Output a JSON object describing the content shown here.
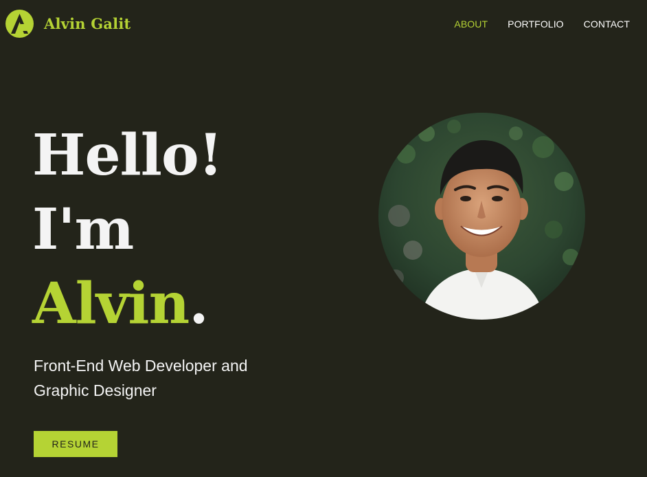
{
  "header": {
    "brand_name": "Alvin Galit",
    "nav": [
      {
        "label": "ABOUT",
        "active": true
      },
      {
        "label": "PORTFOLIO",
        "active": false
      },
      {
        "label": "CONTACT",
        "active": false
      }
    ]
  },
  "hero": {
    "line1": "Hello!",
    "line2": "I'm",
    "name": "Alvin",
    "period": ".",
    "subtitle": "Front-End Web Developer and Graphic Designer",
    "resume_label": "RESUME"
  },
  "colors": {
    "background": "#23241a",
    "accent": "#b5d334",
    "text": "#f4f4f4"
  },
  "icons": {
    "logo": "alvin-logo-icon"
  }
}
